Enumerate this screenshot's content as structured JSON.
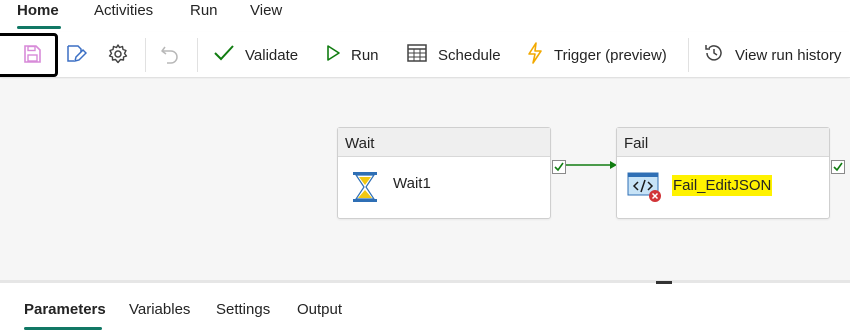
{
  "top_tabs": {
    "items": [
      {
        "label": "Home"
      },
      {
        "label": "Activities"
      },
      {
        "label": "Run"
      },
      {
        "label": "View"
      }
    ],
    "active": "Home"
  },
  "toolbar": {
    "icons": [
      "save-icon",
      "edit-icon",
      "gear-icon",
      "undo-icon"
    ],
    "validate_label": "Validate",
    "run_label": "Run",
    "schedule_label": "Schedule",
    "trigger_label": "Trigger (preview)",
    "view_run_history_label": "View run history"
  },
  "canvas": {
    "nodes": [
      {
        "type": "Wait",
        "name": "Wait1",
        "icon": "hourglass-icon"
      },
      {
        "type": "Fail",
        "name": "Fail_EditJSON",
        "icon": "fail-code-icon",
        "highlighted": true
      }
    ]
  },
  "bottom_tabs": {
    "items": [
      {
        "label": "Parameters"
      },
      {
        "label": "Variables"
      },
      {
        "label": "Settings"
      },
      {
        "label": "Output"
      }
    ],
    "active": "Parameters"
  },
  "colors": {
    "accent": "#117865",
    "success_check": "#107c10",
    "trigger": "#f2a900",
    "highlight": "#fff200",
    "error": "#d13438",
    "save_icon": "#d78ad8"
  }
}
